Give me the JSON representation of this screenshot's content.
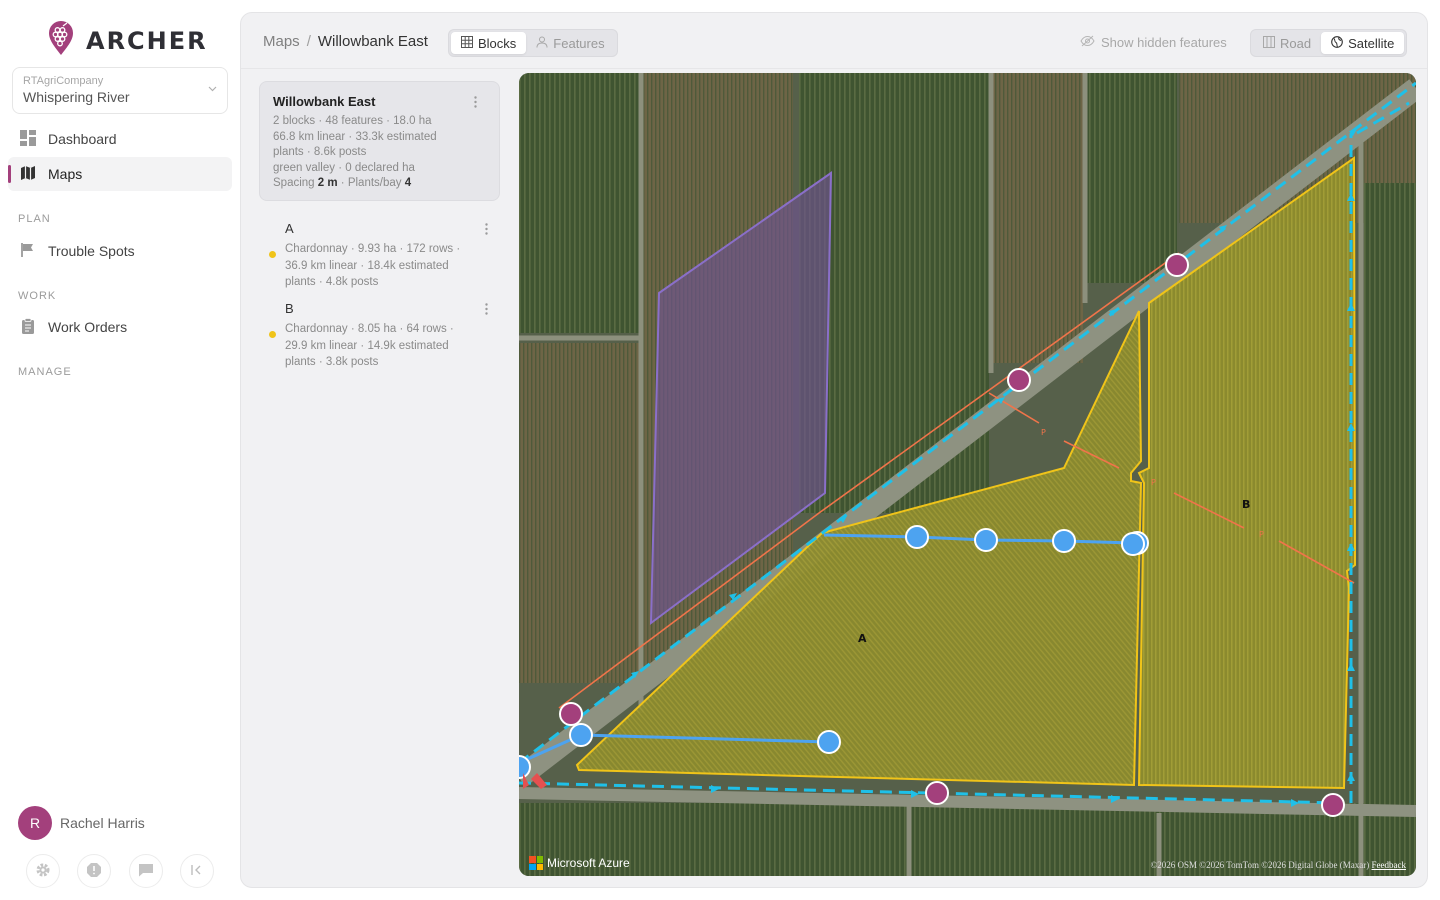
{
  "app": {
    "name": "ARCHER"
  },
  "org": {
    "company": "RTAgriCompany",
    "name": "Whispering River"
  },
  "nav": {
    "dashboard": "Dashboard",
    "maps": "Maps",
    "plan_label": "PLAN",
    "trouble_spots": "Trouble Spots",
    "work_label": "WORK",
    "work_orders": "Work Orders",
    "manage_label": "MANAGE"
  },
  "user": {
    "initial": "R",
    "name": "Rachel Harris"
  },
  "breadcrumb": {
    "parent": "Maps",
    "separator": "/",
    "current": "Willowbank East"
  },
  "view_tabs": {
    "blocks": "Blocks",
    "features": "Features",
    "active": "Blocks"
  },
  "hidden_features": "Show hidden features",
  "map_style": {
    "road": "Road",
    "satellite": "Satellite",
    "active": "Satellite"
  },
  "vineyard": {
    "title": "Willowbank East",
    "line1": "2 blocks · 48 features · 18.0 ha",
    "line2": "66.8 km linear · 33.3k estimated",
    "line3": "plants · 8.6k posts",
    "line4": "green valley · 0 declared ha",
    "spacing_label": "Spacing",
    "spacing_value": "2 m",
    "plants_bay_label": "· Plants/bay",
    "plants_bay_value": "4"
  },
  "blocks": [
    {
      "name": "A",
      "line1": "Chardonnay · 9.93 ha · 172 rows ·",
      "line2": "36.9 km linear · 18.4k estimated",
      "line3": "plants · 4.8k posts",
      "color": "#f0c419"
    },
    {
      "name": "B",
      "line1": "Chardonnay · 8.05 ha · 64 rows ·",
      "line2": "29.9 km linear · 14.9k estimated",
      "line3": "plants · 3.8k posts",
      "color": "#f0c419"
    }
  ],
  "map": {
    "block_labels": {
      "a": "A",
      "b": "B"
    },
    "post_marker": "P",
    "provider": "Microsoft Azure",
    "credits": "©2026 OSM ©2026 TomTom ©2026 Digital Globe (Maxar)",
    "feedback": "Feedback",
    "colors": {
      "block": "#f0c419",
      "route": "#1fc0e8",
      "feature": "#4da3f0",
      "issue": "#a3407c",
      "row_line": "#f0744a"
    }
  },
  "icons": [
    "archer-logo-icon",
    "chevron-down-icon",
    "dashboard-icon",
    "map-icon",
    "flag-icon",
    "clipboard-icon",
    "grid-icon",
    "person-icon",
    "eye-off-icon",
    "road-icon",
    "globe-icon",
    "kebab-icon",
    "settings-icon",
    "alert-icon",
    "chat-icon",
    "collapse-icon"
  ]
}
